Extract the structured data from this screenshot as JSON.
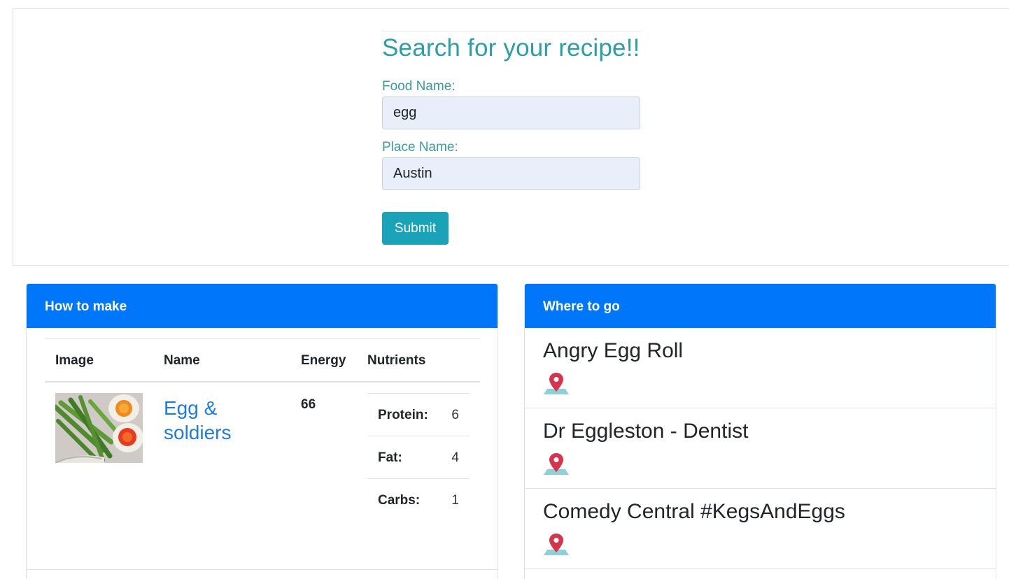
{
  "search": {
    "title": "Search for your recipe!!",
    "food_label": "Food Name:",
    "food_value": "egg",
    "place_label": "Place Name:",
    "place_value": "Austin",
    "submit_label": "Submit"
  },
  "recipes": {
    "header": "How to make",
    "columns": [
      "Image",
      "Name",
      "Energy",
      "Nutrients"
    ],
    "rows": [
      {
        "name": "Egg & soldiers",
        "energy": "66",
        "image_icon": "egg-asparagus-photo",
        "nutrients": [
          {
            "label": "Protein:",
            "value": "6"
          },
          {
            "label": "Fat:",
            "value": "4"
          },
          {
            "label": "Carbs:",
            "value": "1"
          }
        ]
      }
    ]
  },
  "places": {
    "header": "Where to go",
    "pin_icon": "map-pin-icon",
    "items": [
      {
        "name": "Angry Egg Roll"
      },
      {
        "name": "Dr Eggleston - Dentist"
      },
      {
        "name": "Comedy Central #KegsAndEggs"
      }
    ]
  },
  "colors": {
    "accent_teal": "#2a9fa8",
    "button_teal": "#1aa3b8",
    "header_blue": "#0077fb",
    "link_blue": "#1c7ce3",
    "pin_red": "#d7334a",
    "pin_base": "#8fd0d6"
  }
}
